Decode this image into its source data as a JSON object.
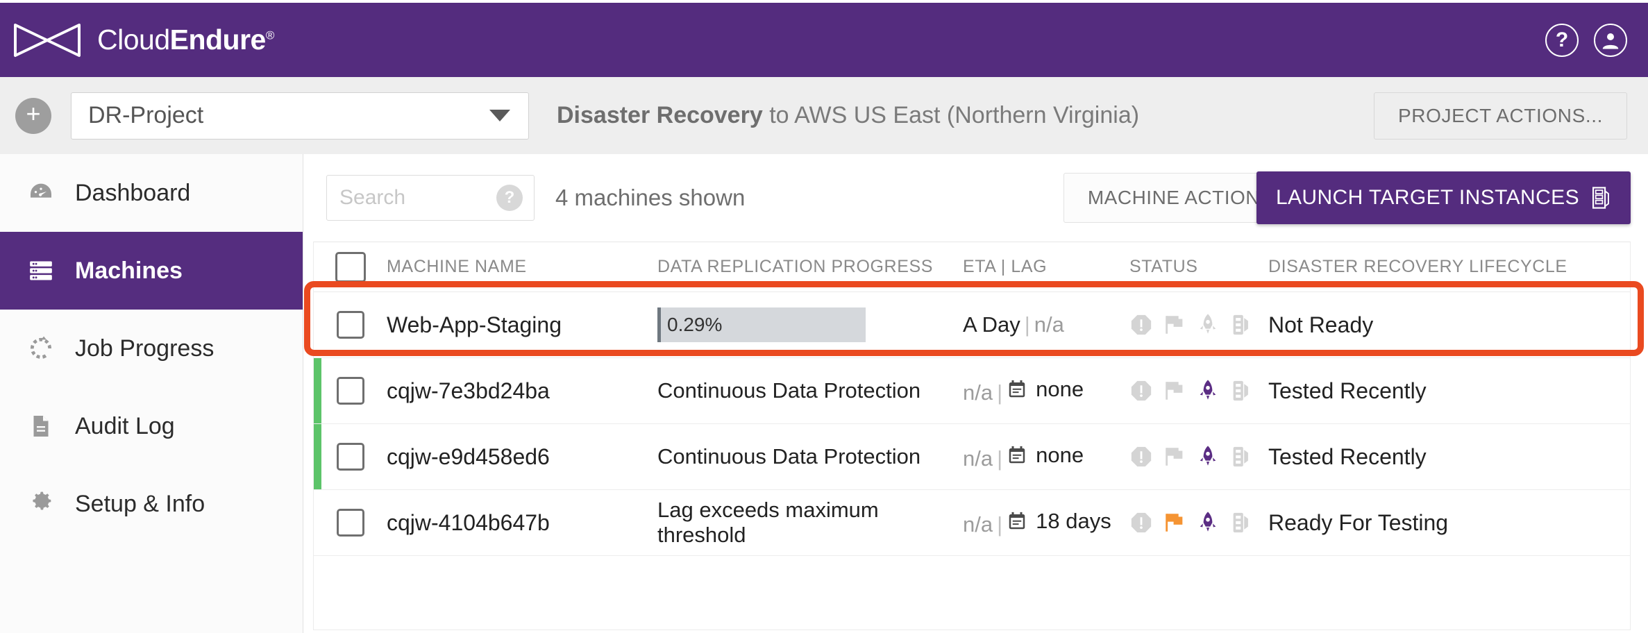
{
  "header": {
    "brand_first": "Cloud",
    "brand_second": "Endure",
    "brand_reg": "®",
    "help_icon": "question-mark-circle-icon",
    "account_icon": "user-circle-icon"
  },
  "projectbar": {
    "add_label": "+",
    "project_value": "DR-Project",
    "title_bold": "Disaster Recovery",
    "title_rest": " to AWS US East (Northern Virginia)",
    "project_actions_label": "PROJECT ACTIONS..."
  },
  "sidebar": {
    "items": [
      {
        "label": "Dashboard",
        "icon": "gauge-icon",
        "active": false
      },
      {
        "label": "Machines",
        "icon": "server-icon",
        "active": true
      },
      {
        "label": "Job Progress",
        "icon": "progress-icon",
        "active": false
      },
      {
        "label": "Audit Log",
        "icon": "document-icon",
        "active": false
      },
      {
        "label": "Setup & Info",
        "icon": "gear-icon",
        "active": false
      }
    ]
  },
  "toolbar": {
    "search_placeholder": "Search",
    "search_value": "",
    "search_help_icon": "question-badge-icon",
    "machines_shown": "4 machines shown",
    "machine_actions_label": "MACHINE ACTIONS...",
    "launch_label": "LAUNCH TARGET INSTANCES",
    "launch_icon": "server-rack-icon"
  },
  "table": {
    "columns": [
      "MACHINE NAME",
      "DATA REPLICATION PROGRESS",
      "ETA | LAG",
      "STATUS",
      "DISASTER RECOVERY LIFECYCLE"
    ],
    "rows": [
      {
        "name": "Web-App-Staging",
        "progress_type": "bar",
        "progress_text": "0.29%",
        "progress_percent": 0.29,
        "eta": "A Day",
        "lag": "n/a",
        "lag_has_calendar": false,
        "status_icons": [
          {
            "name": "alert-icon",
            "color": "#d4d4d4"
          },
          {
            "name": "flag-icon",
            "color": "#d4d4d4"
          },
          {
            "name": "rocket-icon",
            "color": "#d4d4d4"
          },
          {
            "name": "server-icon",
            "color": "#d4d4d4"
          }
        ],
        "lifecycle": "Not Ready",
        "left_marker": "none",
        "highlighted": true
      },
      {
        "name": "cqjw-7e3bd24ba",
        "progress_type": "text",
        "progress_text": "Continuous Data Protection",
        "eta": "n/a",
        "lag": "none",
        "lag_has_calendar": true,
        "status_icons": [
          {
            "name": "alert-icon",
            "color": "#d4d4d4"
          },
          {
            "name": "flag-icon",
            "color": "#d4d4d4"
          },
          {
            "name": "rocket-icon",
            "color": "#5b2d84"
          },
          {
            "name": "server-icon",
            "color": "#d4d4d4"
          }
        ],
        "lifecycle": "Tested Recently",
        "left_marker": "green",
        "highlighted": false
      },
      {
        "name": "cqjw-e9d458ed6",
        "progress_type": "text",
        "progress_text": "Continuous Data Protection",
        "eta": "n/a",
        "lag": "none",
        "lag_has_calendar": true,
        "status_icons": [
          {
            "name": "alert-icon",
            "color": "#d4d4d4"
          },
          {
            "name": "flag-icon",
            "color": "#d4d4d4"
          },
          {
            "name": "rocket-icon",
            "color": "#5b2d84"
          },
          {
            "name": "server-icon",
            "color": "#d4d4d4"
          }
        ],
        "lifecycle": "Tested Recently",
        "left_marker": "green",
        "highlighted": false
      },
      {
        "name": "cqjw-4104b647b",
        "progress_type": "text",
        "progress_text": "Lag exceeds maximum threshold",
        "eta": "n/a",
        "lag": "18 days",
        "lag_has_calendar": true,
        "status_icons": [
          {
            "name": "alert-icon",
            "color": "#d4d4d4"
          },
          {
            "name": "flag-icon",
            "color": "#f59433"
          },
          {
            "name": "rocket-icon",
            "color": "#5b2d84"
          },
          {
            "name": "server-icon",
            "color": "#d4d4d4"
          }
        ],
        "lifecycle": "Ready For Testing",
        "left_marker": "none",
        "highlighted": false
      }
    ]
  },
  "colors": {
    "brand_purple": "#542c7e",
    "highlight_red": "#ea4a20",
    "marker_green": "#5cc469",
    "flag_orange": "#f59433"
  }
}
